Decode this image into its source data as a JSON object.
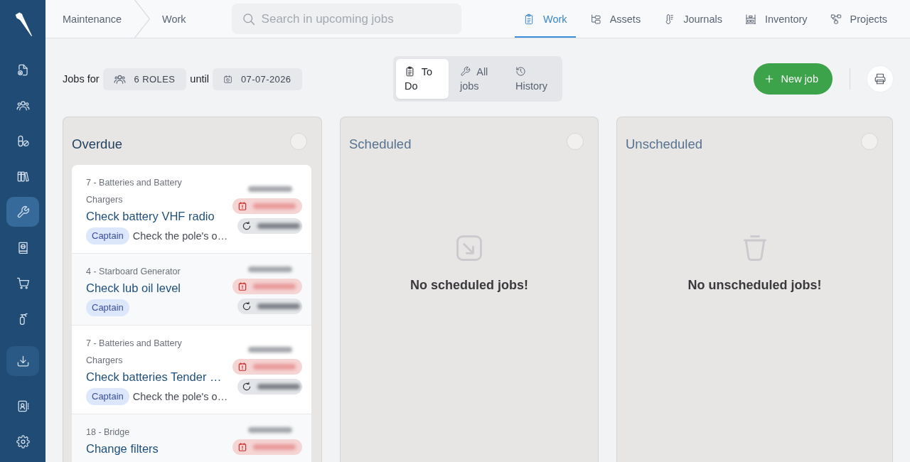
{
  "sidebar": {
    "items": [
      {
        "kind": "nav",
        "selected": false
      },
      {
        "kind": "nav",
        "selected": false
      },
      {
        "kind": "nav",
        "selected": false
      },
      {
        "kind": "nav",
        "selected": false
      },
      {
        "kind": "nav",
        "selected": true
      },
      {
        "kind": "nav",
        "selected": false
      },
      {
        "kind": "nav",
        "selected": false
      },
      {
        "kind": "nav",
        "selected": false
      },
      {
        "kind": "action",
        "selected": false
      },
      {
        "kind": "nav",
        "selected": false
      },
      {
        "kind": "nav",
        "selected": false
      }
    ]
  },
  "breadcrumb": [
    "Maintenance",
    "Work"
  ],
  "search": {
    "placeholder": "Search in upcoming jobs"
  },
  "nav_tabs": [
    {
      "label": "Work",
      "selected": true
    },
    {
      "label": "Assets",
      "selected": false
    },
    {
      "label": "Journals",
      "selected": false
    },
    {
      "label": "Inventory",
      "selected": false
    },
    {
      "label": "Projects",
      "selected": false
    }
  ],
  "filters": {
    "label": "Jobs for",
    "roles": "6 ROLES",
    "until_label": "until",
    "date": "07-07-2026"
  },
  "view_tabs": [
    {
      "label": "To Do",
      "selected": true
    },
    {
      "label": "All jobs",
      "selected": false
    },
    {
      "label": "History",
      "selected": false
    }
  ],
  "new_job_button": {
    "label": "New job"
  },
  "columns": [
    {
      "title": "Overdue",
      "jobs": [
        {
          "asset": "7 - Batteries and Battery Chargers",
          "title": "Check battery VHF radio",
          "role": "Captain",
          "description": "Check the pole's o…",
          "overdue": true,
          "recurring": true
        },
        {
          "asset": "4 - Starboard Generator",
          "title": "Check lub oil level",
          "role": "Captain",
          "overdue": true,
          "recurring": true
        },
        {
          "asset": "7 - Batteries and Battery Chargers",
          "title": "Check batteries Tender …",
          "role": "Captain",
          "description": "Check the pole's o…",
          "overdue": true,
          "recurring": true
        },
        {
          "asset": "18 - Bridge",
          "title": "Change filters",
          "overdue": true,
          "recurring": false
        }
      ]
    },
    {
      "title": "Scheduled",
      "empty_text": "No scheduled jobs!"
    },
    {
      "title": "Unscheduled",
      "empty_text": "No unscheduled jobs!"
    }
  ]
}
